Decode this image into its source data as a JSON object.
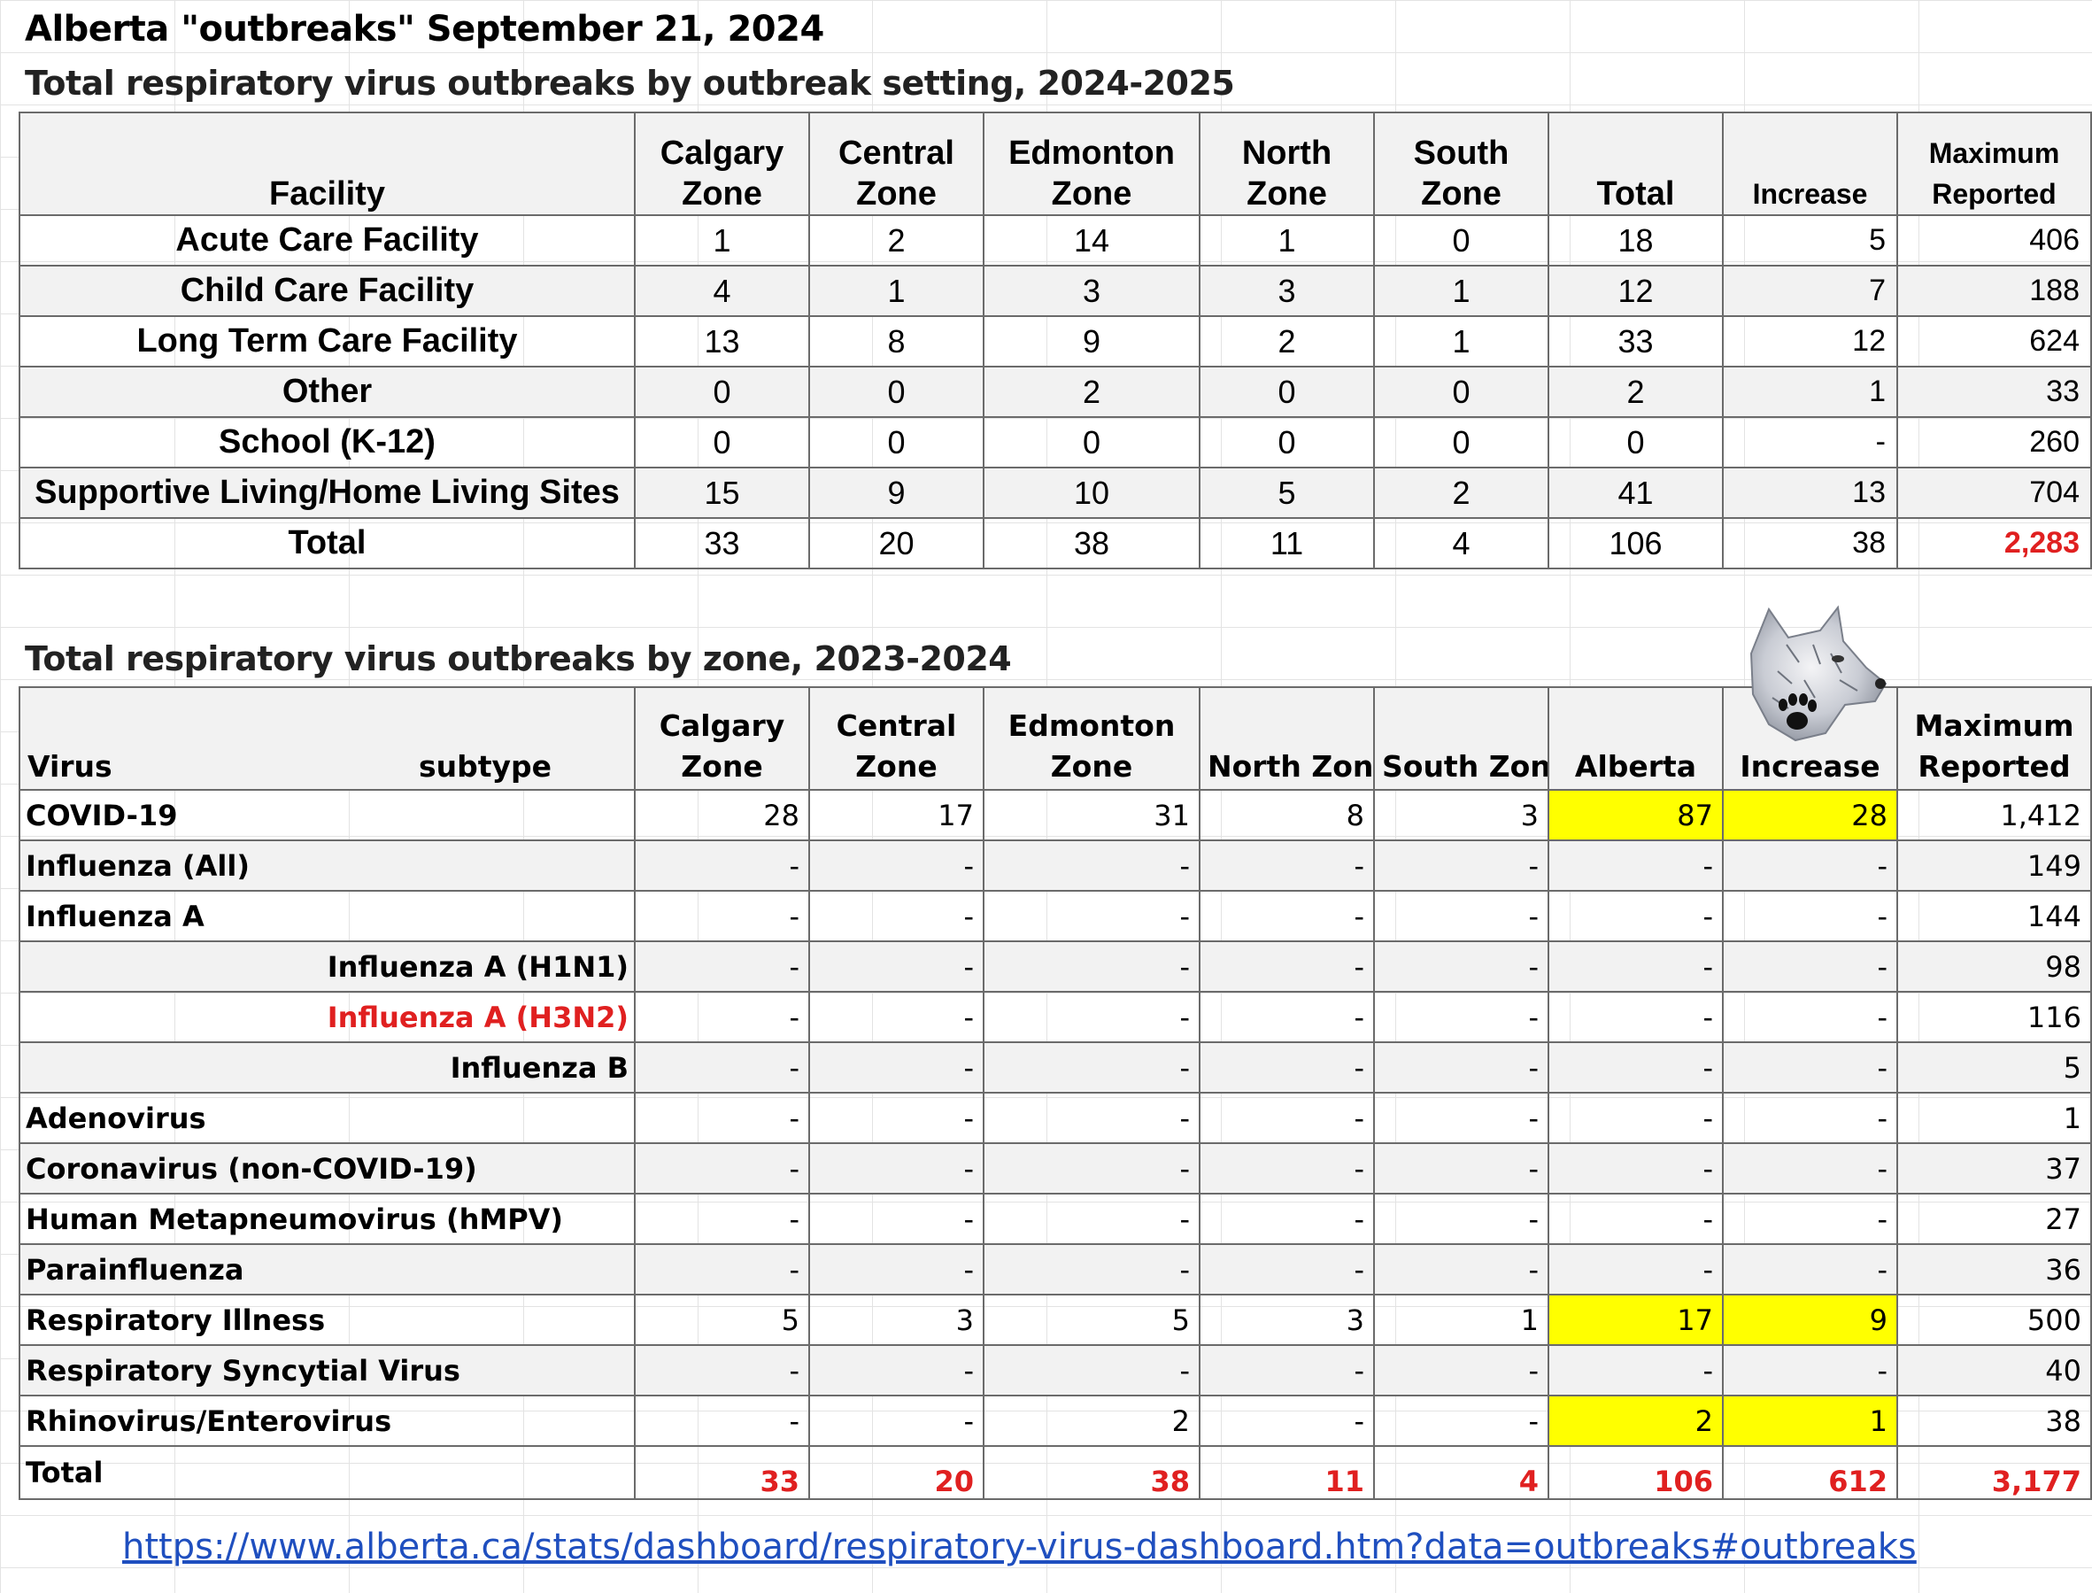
{
  "title": "Alberta \"outbreaks\" September 21, 2024",
  "table1": {
    "subtitle": "Total respiratory virus outbreaks by outbreak setting, 2024-2025",
    "headers": {
      "facility": "Facility",
      "calgary": [
        "Calgary",
        "Zone"
      ],
      "central": [
        "Central",
        "Zone"
      ],
      "edmonton": [
        "Edmonton",
        "Zone"
      ],
      "north": [
        "North",
        "Zone"
      ],
      "south": [
        "South",
        "Zone"
      ],
      "total": "Total",
      "increase": "Increase",
      "maximum": [
        "Maximum",
        "Reported"
      ]
    },
    "rows": [
      {
        "facility": "Acute Care Facility",
        "calgary": "1",
        "central": "2",
        "edmonton": "14",
        "north": "1",
        "south": "0",
        "total": "18",
        "increase": "5",
        "maximum": "406"
      },
      {
        "facility": "Child Care Facility",
        "calgary": "4",
        "central": "1",
        "edmonton": "3",
        "north": "3",
        "south": "1",
        "total": "12",
        "increase": "7",
        "maximum": "188"
      },
      {
        "facility": "Long Term Care Facility",
        "calgary": "13",
        "central": "8",
        "edmonton": "9",
        "north": "2",
        "south": "1",
        "total": "33",
        "increase": "12",
        "maximum": "624"
      },
      {
        "facility": "Other",
        "calgary": "0",
        "central": "0",
        "edmonton": "2",
        "north": "0",
        "south": "0",
        "total": "2",
        "increase": "1",
        "maximum": "33"
      },
      {
        "facility": "School (K-12)",
        "calgary": "0",
        "central": "0",
        "edmonton": "0",
        "north": "0",
        "south": "0",
        "total": "0",
        "increase": "-",
        "maximum": "260"
      },
      {
        "facility": "Supportive Living/Home Living Sites",
        "calgary": "15",
        "central": "9",
        "edmonton": "10",
        "north": "5",
        "south": "2",
        "total": "41",
        "increase": "13",
        "maximum": "704"
      },
      {
        "facility": "Total",
        "calgary": "33",
        "central": "20",
        "edmonton": "38",
        "north": "11",
        "south": "4",
        "total": "106",
        "increase": "38",
        "maximum": "2,283"
      }
    ]
  },
  "table2": {
    "subtitle": "Total respiratory virus outbreaks by zone, 2023-2024",
    "headers": {
      "virus": "Virus",
      "subtype": "subtype",
      "calgary": [
        "Calgary",
        "Zone"
      ],
      "central": [
        "Central",
        "Zone"
      ],
      "edmonton": [
        "Edmonton",
        "Zone"
      ],
      "north": "North Zone",
      "south": "South Zone",
      "alberta": "Alberta",
      "increase": "Increase",
      "maximum": [
        "Maximum",
        "Reported"
      ]
    },
    "rows": [
      {
        "virus": "COVID-19",
        "calgary": "28",
        "central": "17",
        "edmonton": "31",
        "north": "8",
        "south": "3",
        "alberta": "87",
        "increase": "28",
        "maximum": "1,412"
      },
      {
        "virus": "Influenza (All)",
        "calgary": "-",
        "central": "-",
        "edmonton": "-",
        "north": "-",
        "south": "-",
        "alberta": "-",
        "increase": "-",
        "maximum": "149"
      },
      {
        "virus": "Influenza A",
        "calgary": "-",
        "central": "-",
        "edmonton": "-",
        "north": "-",
        "south": "-",
        "alberta": "-",
        "increase": "-",
        "maximum": "144"
      },
      {
        "virus": "Influenza A (H1N1)",
        "calgary": "-",
        "central": "-",
        "edmonton": "-",
        "north": "-",
        "south": "-",
        "alberta": "-",
        "increase": "-",
        "maximum": "98"
      },
      {
        "virus": "Influenza A (H3N2)",
        "calgary": "-",
        "central": "-",
        "edmonton": "-",
        "north": "-",
        "south": "-",
        "alberta": "-",
        "increase": "-",
        "maximum": "116"
      },
      {
        "virus": "Influenza B",
        "calgary": "-",
        "central": "-",
        "edmonton": "-",
        "north": "-",
        "south": "-",
        "alberta": "-",
        "increase": "-",
        "maximum": "5"
      },
      {
        "virus": "Adenovirus",
        "calgary": "-",
        "central": "-",
        "edmonton": "-",
        "north": "-",
        "south": "-",
        "alberta": "-",
        "increase": "-",
        "maximum": "1"
      },
      {
        "virus": "Coronavirus (non-COVID-19)",
        "calgary": "-",
        "central": "-",
        "edmonton": "-",
        "north": "-",
        "south": "-",
        "alberta": "-",
        "increase": "-",
        "maximum": "37"
      },
      {
        "virus": "Human Metapneumovirus (hMPV)",
        "calgary": "-",
        "central": "-",
        "edmonton": "-",
        "north": "-",
        "south": "-",
        "alberta": "-",
        "increase": "-",
        "maximum": "27"
      },
      {
        "virus": "Parainfluenza",
        "calgary": "-",
        "central": "-",
        "edmonton": "-",
        "north": "-",
        "south": "-",
        "alberta": "-",
        "increase": "-",
        "maximum": "36"
      },
      {
        "virus": "Respiratory Illness",
        "calgary": "5",
        "central": "3",
        "edmonton": "5",
        "north": "3",
        "south": "1",
        "alberta": "17",
        "increase": "9",
        "maximum": "500"
      },
      {
        "virus": "Respiratory Syncytial Virus",
        "calgary": "-",
        "central": "-",
        "edmonton": "-",
        "north": "-",
        "south": "-",
        "alberta": "-",
        "increase": "-",
        "maximum": "40"
      },
      {
        "virus": "Rhinovirus/Enterovirus",
        "calgary": "-",
        "central": "-",
        "edmonton": "2",
        "north": "-",
        "south": "-",
        "alberta": "2",
        "increase": "1",
        "maximum": "38"
      },
      {
        "virus": "Total",
        "calgary": "33",
        "central": "20",
        "edmonton": "38",
        "north": "11",
        "south": "4",
        "alberta": "106",
        "increase": "612",
        "maximum": "3,177"
      }
    ]
  },
  "colors": {
    "highlight": "#ffff00",
    "red": "#e02020",
    "link": "#1f4fbf"
  },
  "icons": {
    "decoration": "wolf-head-paw-icon"
  },
  "source_link": "https://www.alberta.ca/stats/dashboard/respiratory-virus-dashboard.htm?data=outbreaks#outbreaks"
}
